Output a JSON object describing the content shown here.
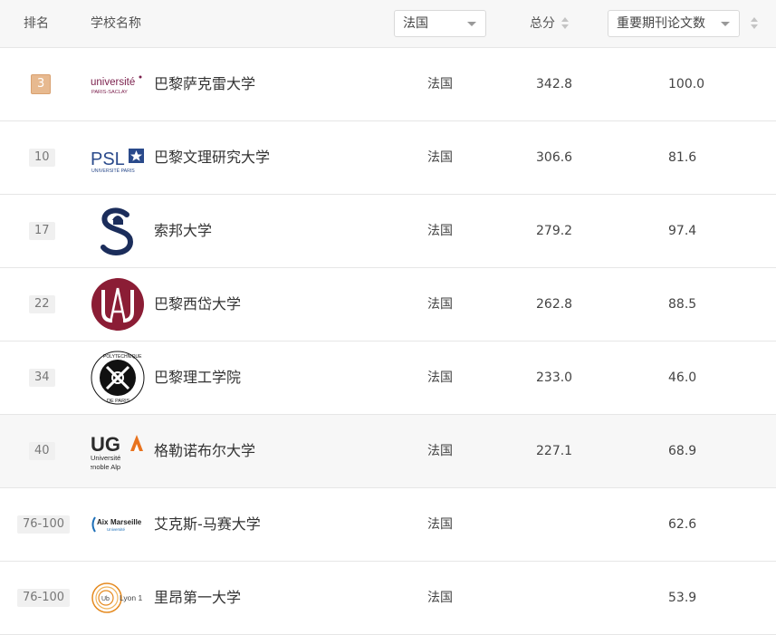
{
  "header": {
    "rank_label": "排名",
    "school_label": "学校名称",
    "country_select": "法国",
    "total_label": "总分",
    "indicator_select": "重要期刊论文数"
  },
  "rows": [
    {
      "rank": "3",
      "logo_text": "université PARIS-SACLAY",
      "name": "巴黎萨克雷大学",
      "country": "法国",
      "score": "342.8",
      "indicator": "100.0"
    },
    {
      "rank": "10",
      "logo_text": "PSL UNIVERSITÉ PARIS",
      "name": "巴黎文理研究大学",
      "country": "法国",
      "score": "306.6",
      "indicator": "81.6"
    },
    {
      "rank": "17",
      "logo_text": "",
      "name": "索邦大学",
      "country": "法国",
      "score": "279.2",
      "indicator": "97.4"
    },
    {
      "rank": "22",
      "logo_text": "",
      "name": "巴黎西岱大学",
      "country": "法国",
      "score": "262.8",
      "indicator": "88.5"
    },
    {
      "rank": "34",
      "logo_text": "POLYTECHNIQUE INSTITUT DE PARIS",
      "name": "巴黎理工学院",
      "country": "法国",
      "score": "233.0",
      "indicator": "46.0"
    },
    {
      "rank": "40",
      "logo_text": "UGA Université Grenoble Alpes",
      "name": "格勒诺布尔大学",
      "country": "法国",
      "score": "227.1",
      "indicator": "68.9"
    },
    {
      "rank": "76-100",
      "logo_text": "Aix Marseille Université",
      "name": "艾克斯-马赛大学",
      "country": "法国",
      "score": "",
      "indicator": "62.6"
    },
    {
      "rank": "76-100",
      "logo_text": "Lyon 1",
      "name": "里昂第一大学",
      "country": "法国",
      "score": "",
      "indicator": "53.9"
    }
  ],
  "colors": {
    "top_badge": "#e7b98f",
    "highlight_row": "#f7f7f7",
    "saclay": "#7b1f4c",
    "psl": "#2a4a8b",
    "sorbonne": "#1b2d5b",
    "cite": "#8b1d35",
    "uga_orange": "#e8731f",
    "lyon_orange": "#e58a1f"
  }
}
